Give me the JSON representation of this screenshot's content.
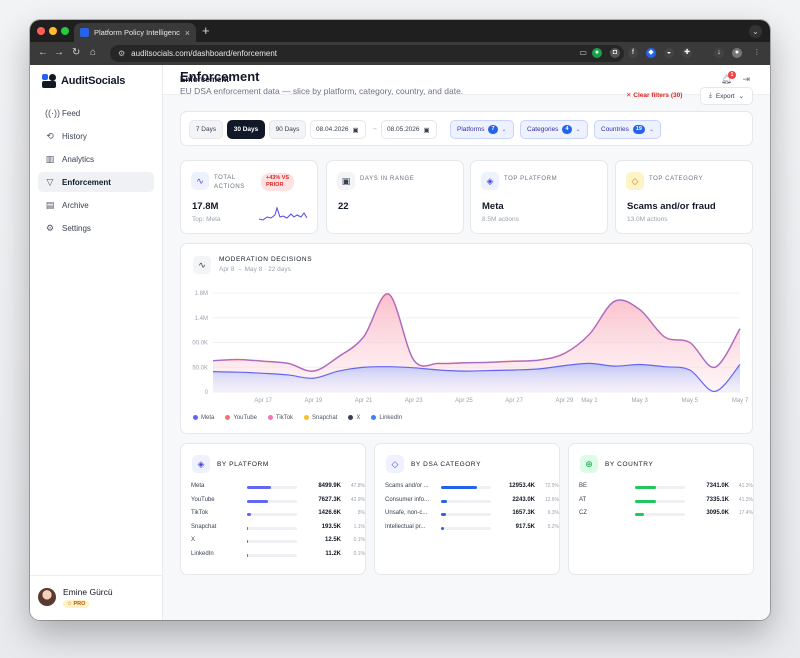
{
  "browser": {
    "tab_title": "Platform Policy Intelligence",
    "url": "auditsocials.com/dashboard/enforcement"
  },
  "brand": {
    "name": "AuditSocials"
  },
  "sidebar": {
    "items": [
      {
        "label": "Feed",
        "icon": "broadcast-icon"
      },
      {
        "label": "History",
        "icon": "history-icon"
      },
      {
        "label": "Analytics",
        "icon": "bar-chart-icon"
      },
      {
        "label": "Enforcement",
        "icon": "filter-icon",
        "active": true
      },
      {
        "label": "Archive",
        "icon": "archive-icon"
      },
      {
        "label": "Settings",
        "icon": "gear-icon"
      }
    ],
    "user": {
      "name": "Emine Gürcü",
      "badge": "PRO"
    }
  },
  "topbar": {
    "breadcrumb": "Enforcement",
    "notification_count": "1"
  },
  "page": {
    "title": "Enforcement",
    "subtitle": "EU DSA enforcement data — slice by platform, category, country, and date.",
    "clear_filters": "Clear filters (30)",
    "export": "Export"
  },
  "filters": {
    "ranges": [
      {
        "label": "7 Days",
        "active": false
      },
      {
        "label": "30 Days",
        "active": true
      },
      {
        "label": "90 Days",
        "active": false
      }
    ],
    "date_from": "08.04.2026",
    "date_to": "08.05.2026",
    "platforms": {
      "label": "Platforms",
      "count": "7"
    },
    "categories": {
      "label": "Categories",
      "count": "4"
    },
    "countries": {
      "label": "Countries",
      "count": "19"
    }
  },
  "kpis": [
    {
      "label_lines": [
        "TOTAL",
        "ACTIONS"
      ],
      "value": "17.8M",
      "sub": "Top: Meta",
      "trend_lines": [
        "+43% VS",
        "PRIOR"
      ]
    },
    {
      "label": "DAYS IN RANGE",
      "value": "22",
      "sub": ""
    },
    {
      "label": "TOP PLATFORM",
      "value": "Meta",
      "sub": "8.5M actions"
    },
    {
      "label": "TOP CATEGORY",
      "value": "Scams and/or fraud",
      "sub": "13.0M actions"
    }
  ],
  "chart": {
    "title": "MODERATION DECISIONS",
    "subtitle": "Apr 8 → May 8 · 22 days",
    "legend": [
      {
        "name": "Meta",
        "color": "#6366f1"
      },
      {
        "name": "YouTube",
        "color": "#f87171"
      },
      {
        "name": "TikTok",
        "color": "#f472b6"
      },
      {
        "name": "Snapchat",
        "color": "#fbbf24"
      },
      {
        "name": "X",
        "color": "#374151"
      },
      {
        "name": "LinkedIn",
        "color": "#3b82f6"
      }
    ]
  },
  "chart_data": {
    "type": "area",
    "y_tick_labels": [
      "1.8M",
      "1.4M",
      "00.0K",
      "50.0K",
      "0"
    ],
    "y_tick_values": [
      1800000,
      1350000,
      900000,
      450000,
      0
    ],
    "x_tick_labels": [
      "Apr 17",
      "Apr 19",
      "Apr 21",
      "Apr 23",
      "Apr 25",
      "Apr 27",
      "Apr 29",
      "May 1",
      "May 3",
      "May 5",
      "May 7"
    ],
    "x": [
      "Apr 15",
      "Apr 16",
      "Apr 17",
      "Apr 18",
      "Apr 19",
      "Apr 20",
      "Apr 21",
      "Apr 22",
      "Apr 23",
      "Apr 24",
      "Apr 25",
      "Apr 26",
      "Apr 27",
      "Apr 28",
      "Apr 29",
      "May 1",
      "May 2",
      "May 3",
      "May 4",
      "May 5",
      "May 6",
      "May 7"
    ],
    "series": [
      {
        "name": "YouTube",
        "values": [
          570000,
          590000,
          560000,
          520000,
          380000,
          640000,
          1000000,
          1780000,
          580000,
          520000,
          530000,
          540000,
          560000,
          580000,
          700000,
          1050000,
          1650000,
          1500000,
          1000000,
          900000,
          450000,
          1150000
        ]
      },
      {
        "name": "Meta",
        "values": [
          370000,
          360000,
          340000,
          310000,
          250000,
          380000,
          450000,
          460000,
          440000,
          400000,
          380000,
          390000,
          400000,
          420000,
          480000,
          520000,
          470000,
          500000,
          460000,
          400000,
          10000,
          500000
        ]
      }
    ],
    "ylim": [
      0,
      1800000
    ]
  },
  "breakdowns": {
    "platform": {
      "title": "BY PLATFORM",
      "rows": [
        {
          "label": "Meta",
          "value": "8499.9K",
          "pct": "47.8%",
          "fill": 0.478,
          "color": "#6366f1"
        },
        {
          "label": "YouTube",
          "value": "7627.3K",
          "pct": "42.9%",
          "fill": 0.429,
          "color": "#6366f1"
        },
        {
          "label": "TikTok",
          "value": "1426.6K",
          "pct": "8%",
          "fill": 0.08,
          "color": "#6366f1"
        },
        {
          "label": "Snapchat",
          "value": "193.5K",
          "pct": "1.1%",
          "fill": 0.011,
          "color": "#6366f1"
        },
        {
          "label": "X",
          "value": "12.5K",
          "pct": "0.1%",
          "fill": 0.001,
          "color": "#6366f1"
        },
        {
          "label": "LinkedIn",
          "value": "11.2K",
          "pct": "0.1%",
          "fill": 0.001,
          "color": "#6366f1"
        }
      ]
    },
    "category": {
      "title": "BY DSA CATEGORY",
      "rows": [
        {
          "label": "Scams and/or ...",
          "value": "12953.4K",
          "pct": "72.9%",
          "fill": 0.729,
          "color": "#2563eb"
        },
        {
          "label": "Consumer info...",
          "value": "2243.0K",
          "pct": "12.6%",
          "fill": 0.126,
          "color": "#2563eb"
        },
        {
          "label": "Unsafe, non-c...",
          "value": "1657.3K",
          "pct": "9.3%",
          "fill": 0.093,
          "color": "#2563eb"
        },
        {
          "label": "Intellectual pr...",
          "value": "917.5K",
          "pct": "5.2%",
          "fill": 0.052,
          "color": "#2563eb"
        }
      ]
    },
    "country": {
      "title": "BY COUNTRY",
      "rows": [
        {
          "label": "BE",
          "value": "7341.0K",
          "pct": "41.3%",
          "fill": 0.413,
          "color": "#22c55e"
        },
        {
          "label": "AT",
          "value": "7335.1K",
          "pct": "41.3%",
          "fill": 0.413,
          "color": "#22c55e"
        },
        {
          "label": "CZ",
          "value": "3095.0K",
          "pct": "17.4%",
          "fill": 0.174,
          "color": "#22c55e"
        }
      ]
    }
  }
}
